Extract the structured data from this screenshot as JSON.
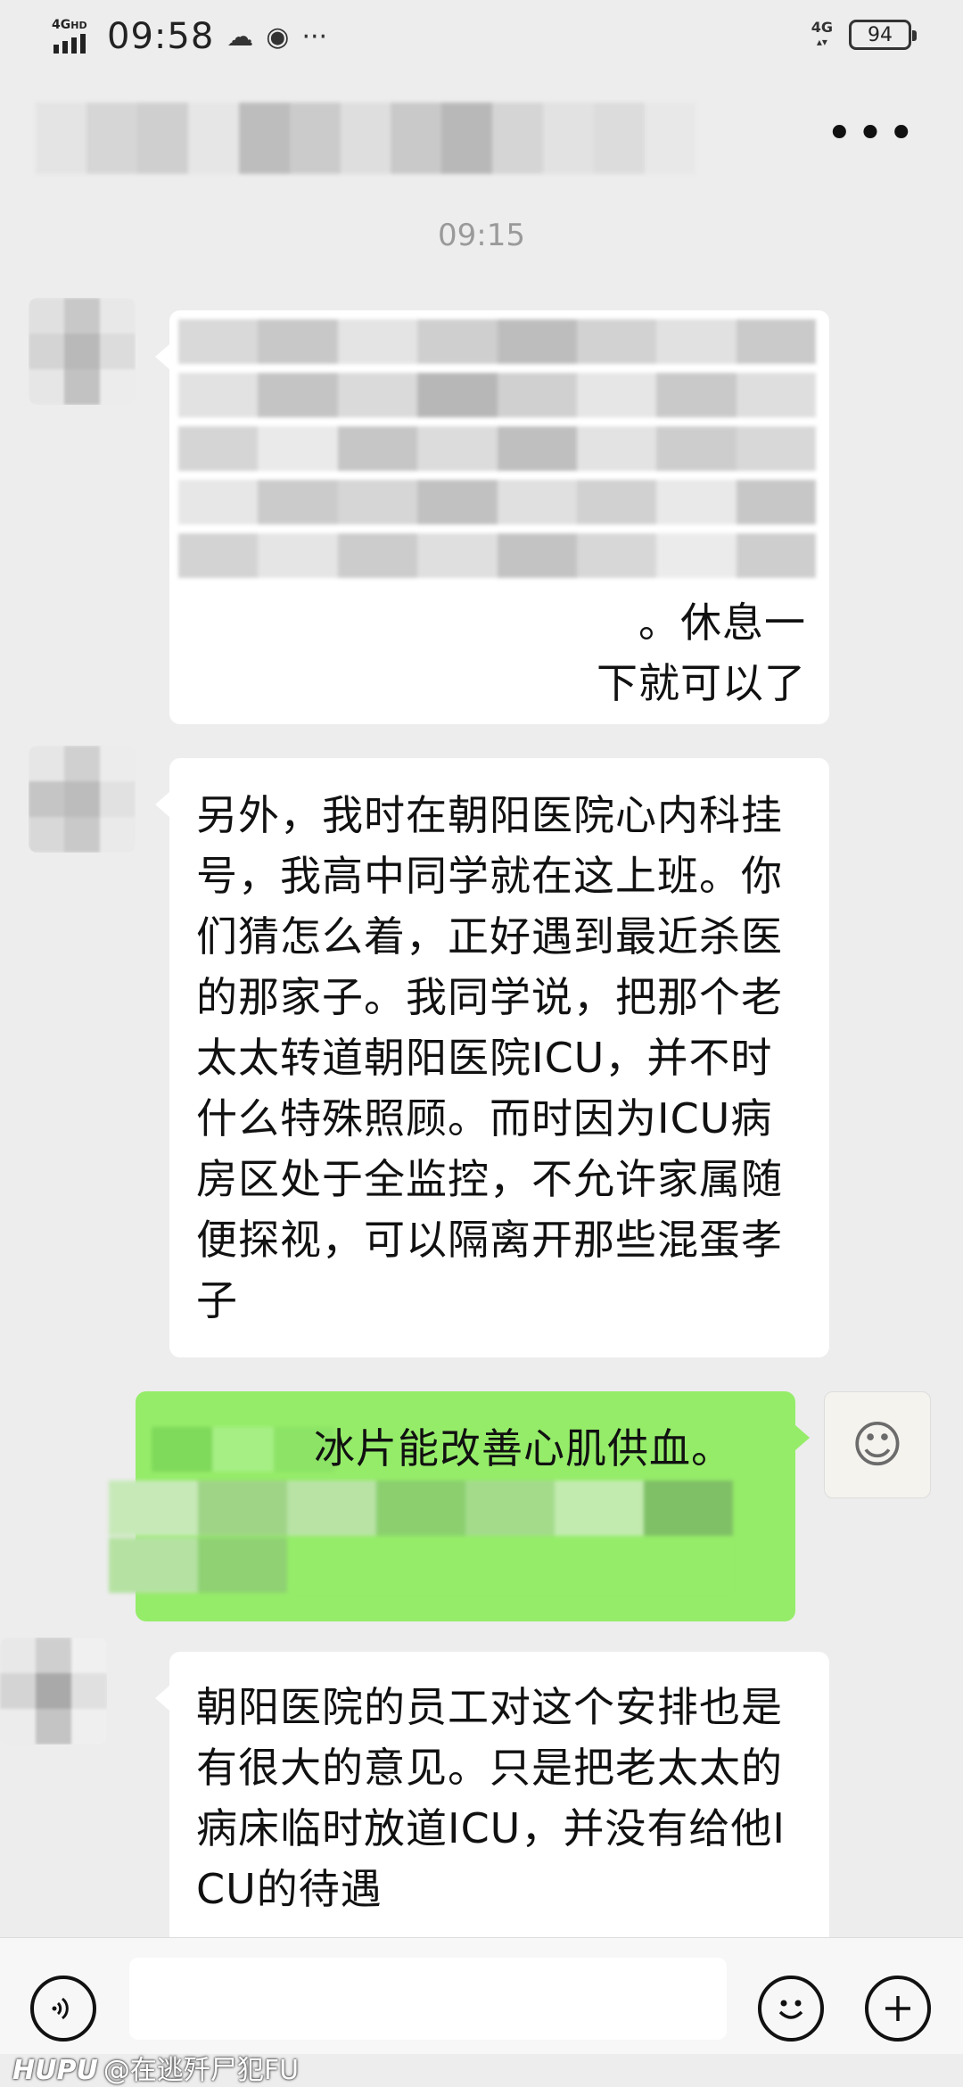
{
  "status_bar": {
    "network_type_left": "4G",
    "network_hd": "HD",
    "time": "09:58",
    "network_type_right": "4G",
    "battery_level": "94"
  },
  "header": {
    "contact_name_redacted": true
  },
  "chat": {
    "timestamp": "09:15",
    "messages": [
      {
        "sender": "contact",
        "text": "。休息一\n下就可以了",
        "partially_redacted": true
      },
      {
        "sender": "contact",
        "text": "另外，我时在朝阳医院心内科挂号，我高中同学就在这上班。你们猜怎么着，正好遇到最近杀医的那家子。我同学说，把那个老太太转道朝阳医院ICU，并不时什么特殊照顾。而时因为ICU病房区处于全监控，不允许家属随便探视，可以隔离开那些混蛋孝子"
      },
      {
        "sender": "self",
        "text": "冰片能改善心肌供血。",
        "partially_redacted": true
      },
      {
        "sender": "contact",
        "text": "朝阳医院的员工对这个安排也是有很大的意见。只是把老太太的病床临时放道ICU，并没有给他ICU的待遇"
      }
    ]
  },
  "input_bar": {
    "voice_icon": "voice-icon",
    "emoji_icon": "emoji-icon",
    "plus_icon": "plus-icon",
    "input_value": ""
  },
  "watermark": {
    "brand": "HUPU",
    "handle": "@在逃歼尸犯FU"
  },
  "colors": {
    "background": "#ededed",
    "bubble_in": "#ffffff",
    "bubble_out": "#95ec69",
    "timestamp": "#9a9a9a"
  }
}
